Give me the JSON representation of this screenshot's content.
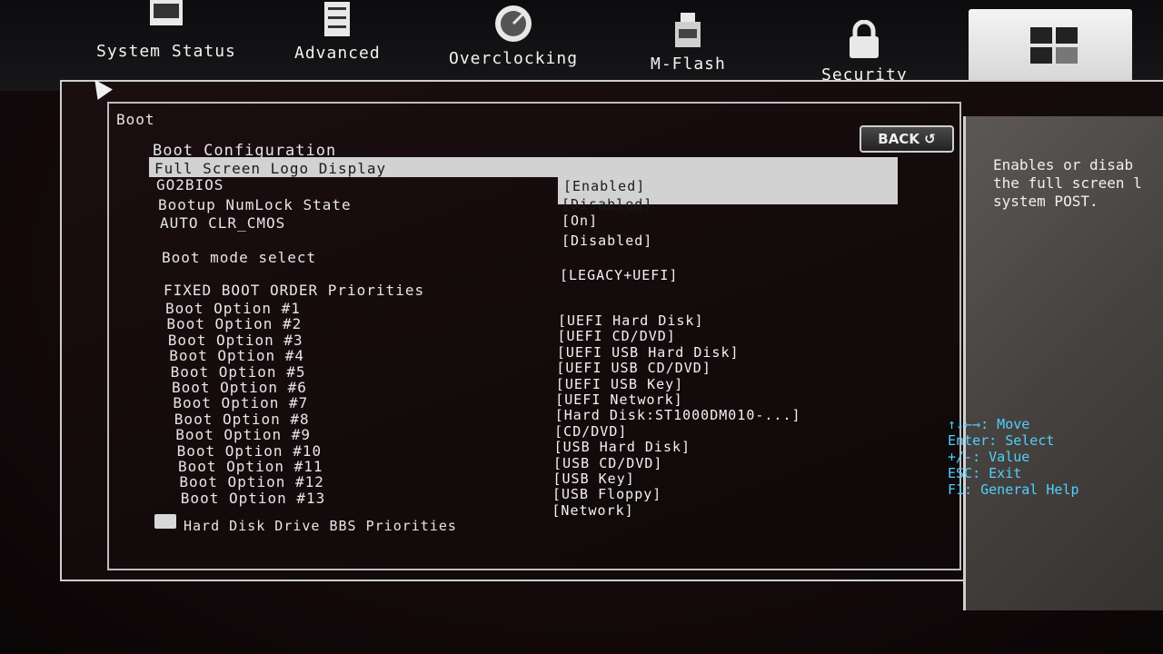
{
  "tabs": [
    {
      "label": "System Status",
      "icon": "monitor-icon"
    },
    {
      "label": "Advanced",
      "icon": "sliders-icon"
    },
    {
      "label": "Overclocking",
      "icon": "gauge-icon"
    },
    {
      "label": "M-Flash",
      "icon": "usb-bios-icon"
    },
    {
      "label": "Security",
      "icon": "lock-icon"
    },
    {
      "label": "",
      "icon": "boot-icon"
    }
  ],
  "page": {
    "title": "Boot",
    "section": "Boot Configuration",
    "back_label": "BACK ↺"
  },
  "settings": [
    {
      "name": "Full Screen Logo Display",
      "value": "[Enabled]"
    },
    {
      "name": "GO2BIOS",
      "value": "[Disabled]"
    },
    {
      "name": "Bootup NumLock State",
      "value": "[On]"
    },
    {
      "name": "AUTO CLR_CMOS",
      "value": "[Disabled]"
    },
    {
      "name": "Boot mode select",
      "value": "[LEGACY+UEFI]"
    }
  ],
  "fixed_order_title": "FIXED BOOT ORDER Priorities",
  "boot_options": [
    {
      "name": "Boot Option #1",
      "value": "[UEFI Hard Disk]"
    },
    {
      "name": "Boot Option #2",
      "value": "[UEFI CD/DVD]"
    },
    {
      "name": "Boot Option #3",
      "value": "[UEFI USB Hard Disk]"
    },
    {
      "name": "Boot Option #4",
      "value": "[UEFI USB CD/DVD]"
    },
    {
      "name": "Boot Option #5",
      "value": "[UEFI USB Key]"
    },
    {
      "name": "Boot Option #6",
      "value": "[UEFI Network]"
    },
    {
      "name": "Boot Option #7",
      "value": "[Hard Disk:ST1000DM010-...]"
    },
    {
      "name": "Boot Option #8",
      "value": "[CD/DVD]"
    },
    {
      "name": "Boot Option #9",
      "value": "[USB Hard Disk]"
    },
    {
      "name": "Boot Option #10",
      "value": "[USB CD/DVD]"
    },
    {
      "name": "Boot Option #11",
      "value": "[USB Key]"
    },
    {
      "name": "Boot Option #12",
      "value": "[USB Floppy]"
    },
    {
      "name": "Boot Option #13",
      "value": "[Network]"
    }
  ],
  "hdd_priorities": "Hard Disk Drive BBS Priorities",
  "help": {
    "text": "Enables or disab\nthe full screen l\nsystem POST.",
    "keys": [
      "↑↓←→: Move",
      "Enter: Select",
      "+/-: Value",
      "ESC: Exit",
      "F1: General Help"
    ]
  },
  "colors": {
    "highlight": "#d2d2d2",
    "key_help": "#4fd0ff"
  }
}
